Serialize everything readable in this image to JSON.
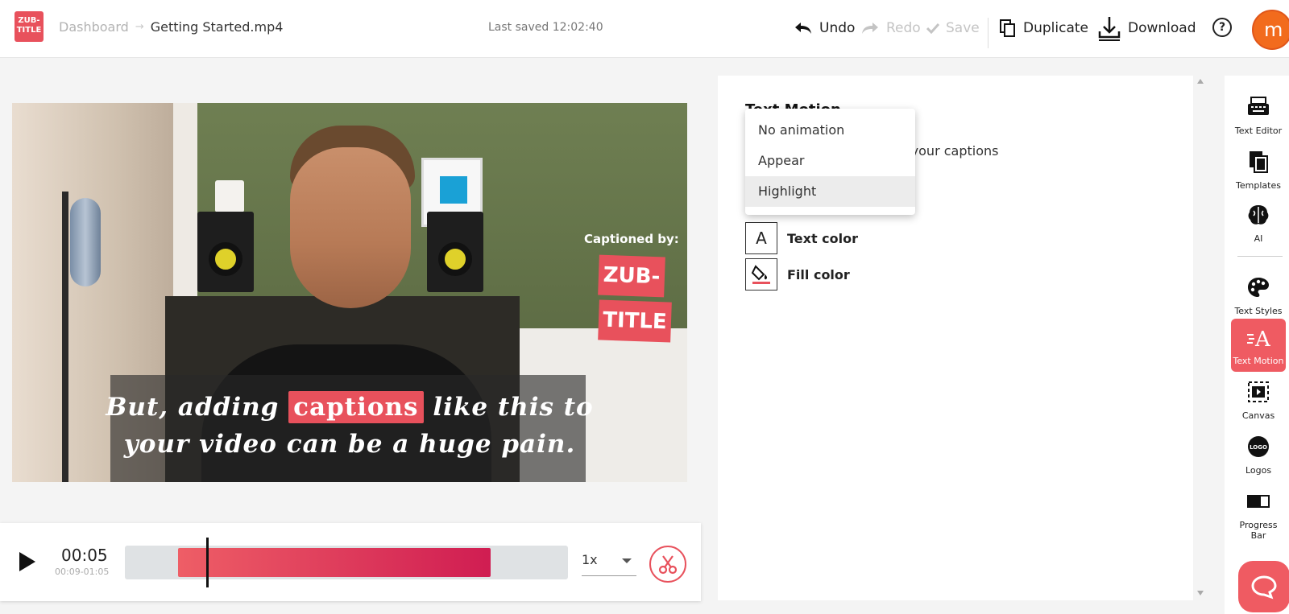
{
  "header": {
    "logo_text": "ZUB-TITLE",
    "breadcrumb_root": "Dashboard",
    "breadcrumb_current": "Getting Started.mp4",
    "last_saved": "Last saved 12:02:40",
    "undo_label": "Undo",
    "redo_label": "Redo",
    "save_label": "Save",
    "duplicate_label": "Duplicate",
    "download_label": "Download",
    "help_label": "?",
    "avatar_initial": "m"
  },
  "video": {
    "caption_line1_before": "But, adding",
    "caption_highlight": "captions",
    "caption_line1_after": "like this to",
    "caption_line2": "your video can be a huge pain.",
    "byline": "Captioned by:",
    "badge_line1": "ZUB-",
    "badge_line2": "TITLE"
  },
  "player": {
    "current_time": "00:05",
    "range": "00:09-01:05",
    "speed": "1x",
    "selection_start_fraction": 0.12,
    "selection_end_fraction": 0.825,
    "playhead_fraction": 0.184
  },
  "panel": {
    "title": "Text Motion",
    "description": "r your captions",
    "text_color_label": "Text color",
    "text_color_icon": "A",
    "fill_color_label": "Fill color",
    "accent": "#e8515c"
  },
  "dropdown": {
    "options": [
      "No animation",
      "Appear",
      "Highlight"
    ],
    "selected": "Highlight"
  },
  "rail": {
    "items": [
      {
        "label": "Text Editor",
        "icon": "typewriter-icon"
      },
      {
        "label": "Templates",
        "icon": "templates-icon"
      },
      {
        "label": "AI",
        "icon": "brain-icon"
      },
      {
        "label": "Text Styles",
        "icon": "palette-icon"
      },
      {
        "label": "Text Motion",
        "icon": "text-motion-icon"
      },
      {
        "label": "Canvas",
        "icon": "canvas-icon"
      },
      {
        "label": "Logos",
        "icon": "logo-icon"
      },
      {
        "label": "Progress Bar",
        "icon": "progress-bar-icon"
      }
    ],
    "active": "Text Motion"
  }
}
